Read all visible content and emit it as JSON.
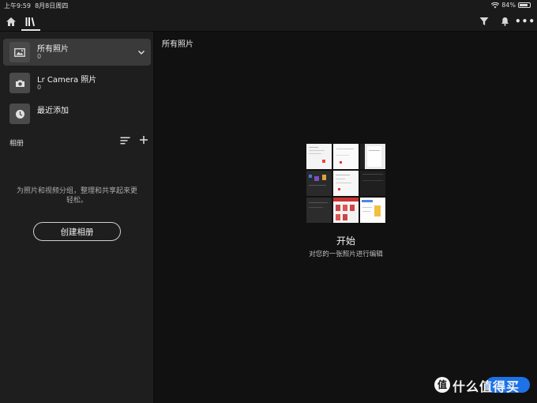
{
  "status": {
    "time": "上午9:59",
    "date": "8月8日周四",
    "battery": "84%",
    "battery_level": 0.84
  },
  "topbar": {
    "icons": [
      "home-icon",
      "library-icon",
      "filter-icon",
      "bell-icon",
      "more-icon"
    ],
    "more_label": "•••"
  },
  "sidebar": {
    "sources": [
      {
        "title": "所有照片",
        "count": "0",
        "icon": "photo-icon"
      },
      {
        "title": "Lr Camera 照片",
        "count": "0",
        "icon": "camera-icon"
      },
      {
        "title": "最近添加",
        "count": "",
        "icon": "clock-icon"
      }
    ],
    "albums_label": "相册",
    "hint": "为照片和视频分组，整理和共享起来更轻松。",
    "create_album": "创建相册"
  },
  "main": {
    "title": "所有照片",
    "start_title": "开始",
    "start_subtitle": "对您的一张照片进行编辑"
  },
  "watermark": {
    "text": "什么值得买",
    "logo": "值"
  },
  "colors": {
    "sidebar_bg": "#1e1e1e",
    "main_bg": "#111111",
    "active_item": "#3a3a3a",
    "accent_blue": "#1d72e8"
  }
}
